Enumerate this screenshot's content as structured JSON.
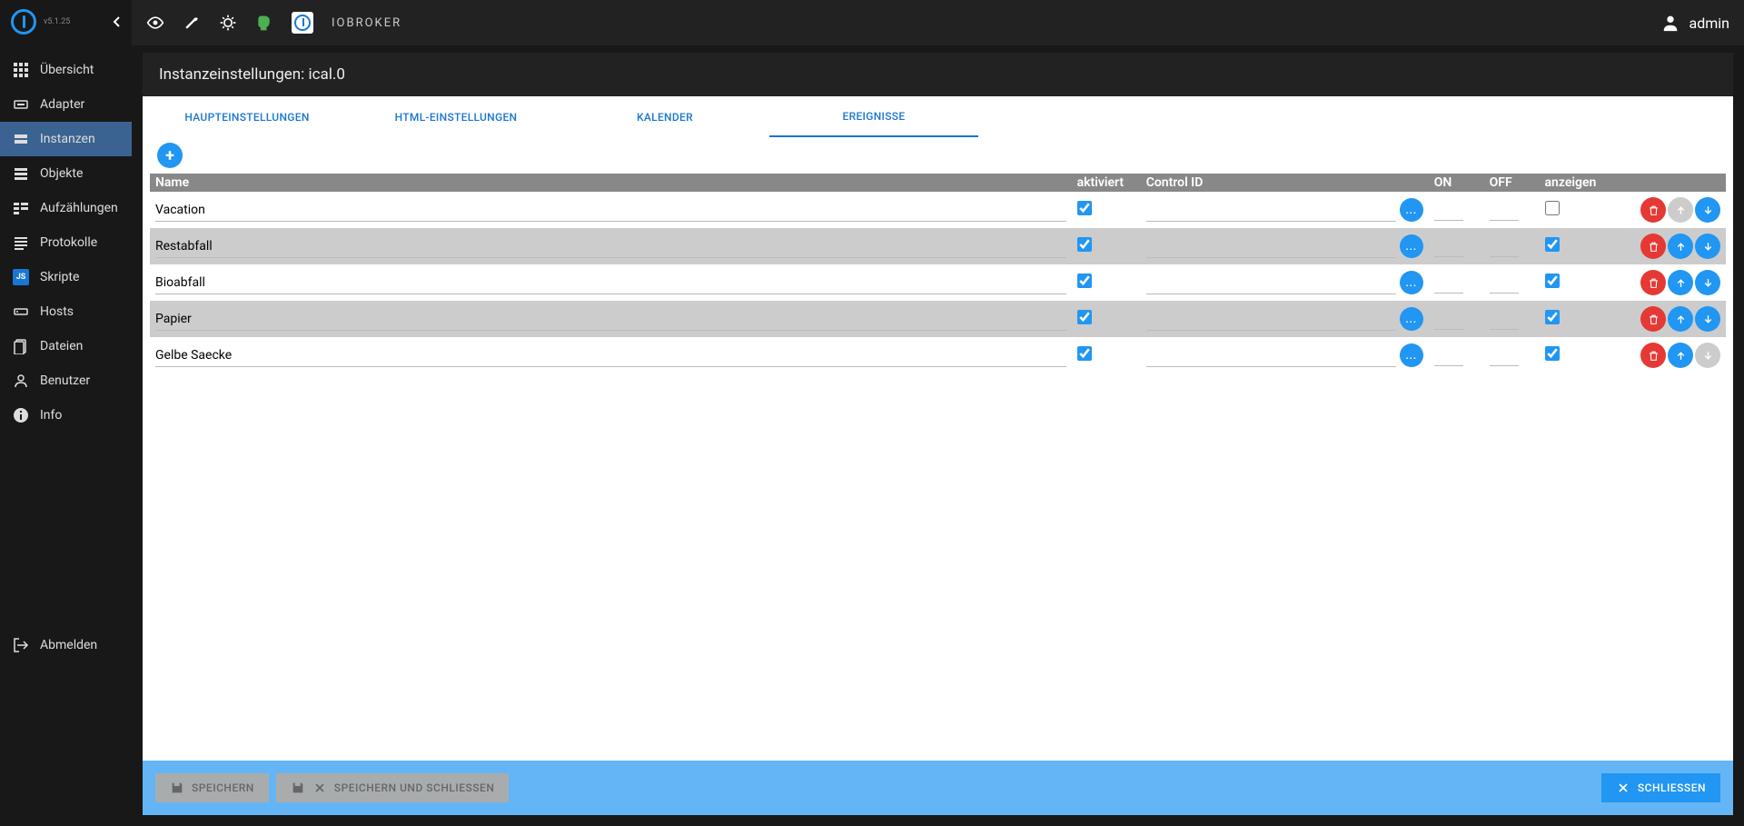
{
  "version": "v5.1.25",
  "brand": "IOBROKER",
  "user": "admin",
  "sidebar": {
    "items": [
      {
        "label": "Übersicht"
      },
      {
        "label": "Adapter"
      },
      {
        "label": "Instanzen"
      },
      {
        "label": "Objekte"
      },
      {
        "label": "Aufzählungen"
      },
      {
        "label": "Protokolle"
      },
      {
        "label": "Skripte"
      },
      {
        "label": "Hosts"
      },
      {
        "label": "Dateien"
      },
      {
        "label": "Benutzer"
      },
      {
        "label": "Info"
      }
    ],
    "logout": "Abmelden"
  },
  "page_title": "Instanzeinstellungen: ical.0",
  "tabs": [
    {
      "label": "HAUPTEINSTELLUNGEN"
    },
    {
      "label": "HTML-EINSTELLUNGEN"
    },
    {
      "label": "KALENDER"
    },
    {
      "label": "EREIGNISSE"
    }
  ],
  "columns": {
    "name": "Name",
    "enabled": "aktiviert",
    "control_id": "Control ID",
    "on": "ON",
    "off": "OFF",
    "display": "anzeigen"
  },
  "rows": [
    {
      "name": "Vacation",
      "enabled": true,
      "display": false,
      "up_disabled": true,
      "down_disabled": false
    },
    {
      "name": "Restabfall",
      "enabled": true,
      "display": true,
      "up_disabled": false,
      "down_disabled": false
    },
    {
      "name": "Bioabfall",
      "enabled": true,
      "display": true,
      "up_disabled": false,
      "down_disabled": false
    },
    {
      "name": "Papier",
      "enabled": true,
      "display": true,
      "up_disabled": false,
      "down_disabled": false
    },
    {
      "name": "Gelbe Saecke",
      "enabled": true,
      "display": true,
      "up_disabled": false,
      "down_disabled": true
    }
  ],
  "footer": {
    "save": "SPEICHERN",
    "save_close": "SPEICHERN UND SCHLIESSEN",
    "close": "SCHLIESSEN"
  }
}
